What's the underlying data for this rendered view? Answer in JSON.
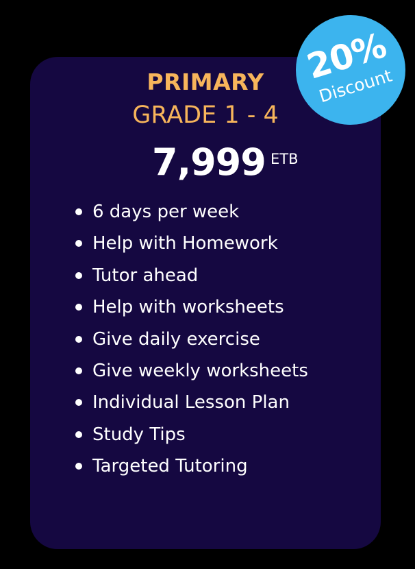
{
  "colors": {
    "background": "#000000",
    "card": "#150841",
    "accent": "#f7b55b",
    "badge": "#3cb4ee",
    "text": "#ffffff"
  },
  "plan": {
    "tier": "PRIMARY",
    "grade": "GRADE 1 - 4",
    "price": "7,999",
    "currency": "ETB"
  },
  "badge": {
    "percent": "20%",
    "label": "Discount"
  },
  "features": [
    "6 days per week",
    "Help with Homework",
    "Tutor ahead",
    "Help with worksheets",
    "Give daily exercise",
    "Give weekly worksheets",
    "Individual Lesson Plan",
    "Study Tips",
    "Targeted Tutoring"
  ]
}
